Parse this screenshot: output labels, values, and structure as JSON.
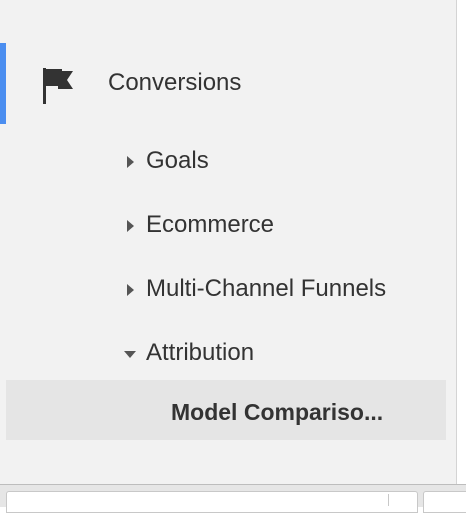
{
  "sidebar": {
    "section": {
      "title": "Conversions",
      "icon": "flag-icon",
      "accent_color": "#4b8ef0"
    },
    "items": [
      {
        "label": "Goals",
        "expanded": false,
        "icon": "caret-right-icon"
      },
      {
        "label": "Ecommerce",
        "expanded": false,
        "icon": "caret-right-icon"
      },
      {
        "label": "Multi-Channel Funnels",
        "expanded": false,
        "icon": "caret-right-icon"
      },
      {
        "label": "Attribution",
        "expanded": true,
        "icon": "caret-down-icon"
      }
    ],
    "selected_subitem": {
      "label": "Model Compariso..."
    }
  }
}
